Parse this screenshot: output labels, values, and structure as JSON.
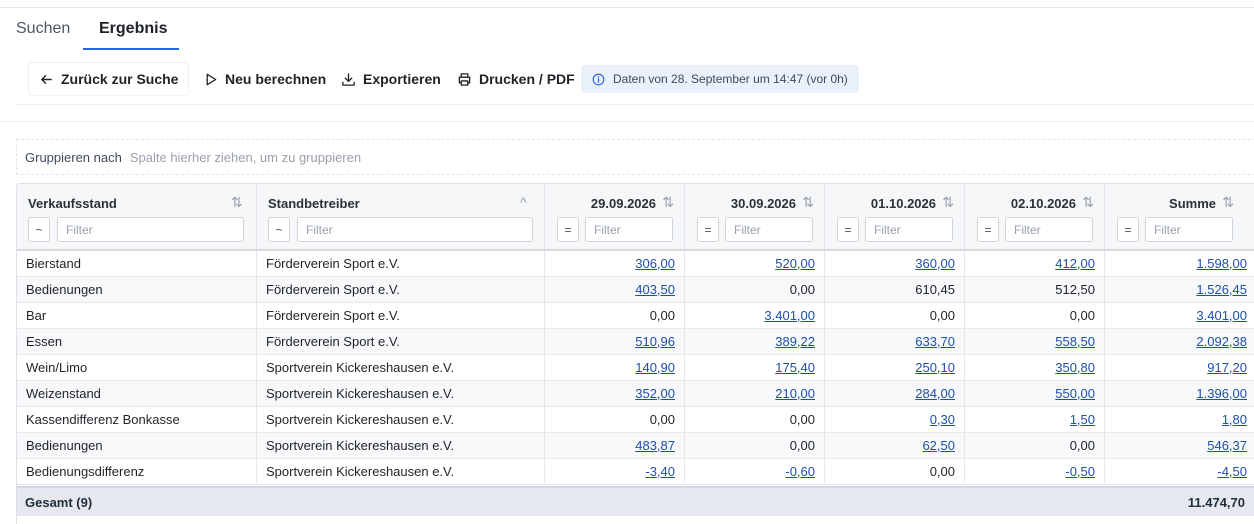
{
  "tabs": [
    {
      "label": "Suchen",
      "active": false
    },
    {
      "label": "Ergebnis",
      "active": true
    }
  ],
  "toolbar": {
    "back_label": "Zurück zur Suche",
    "recalc_label": "Neu berechnen",
    "export_label": "Exportieren",
    "print_label": "Drucken / PDF",
    "info_text": "Daten von 28. September um 14:47 (vor 0h)"
  },
  "group_bar": {
    "label": "Gruppieren nach",
    "hint": "Spalte hierher ziehen, um zu gruppieren"
  },
  "columns": [
    {
      "title": "Verkaufsstand",
      "sort": "⇅",
      "filter_op": "~",
      "filter_placeholder": "Filter"
    },
    {
      "title": "Standbetreiber",
      "sort": "^",
      "filter_op": "~",
      "filter_placeholder": "Filter"
    },
    {
      "title": "29.09.2026",
      "sort": "⇅",
      "filter_op": "=",
      "filter_placeholder": "Filter"
    },
    {
      "title": "30.09.2026",
      "sort": "⇅",
      "filter_op": "=",
      "filter_placeholder": "Filter"
    },
    {
      "title": "01.10.2026",
      "sort": "⇅",
      "filter_op": "=",
      "filter_placeholder": "Filter"
    },
    {
      "title": "02.10.2026",
      "sort": "⇅",
      "filter_op": "=",
      "filter_placeholder": "Filter"
    },
    {
      "title": "Summe",
      "sort": "⇅",
      "filter_op": "=",
      "filter_placeholder": "Filter"
    }
  ],
  "rows": [
    {
      "stand": "Bierstand",
      "operator": "Förderverein Sport e.V.",
      "d1": "306,00",
      "d2": "520,00",
      "d3": "360,00",
      "d4": "412,00",
      "sum": "1.598,00"
    },
    {
      "stand": "Bedienungen",
      "operator": "Förderverein Sport e.V.",
      "d1": "403,50",
      "d2": "0,00",
      "d3": "610,45",
      "d4": "512,50",
      "sum": "1.526,45"
    },
    {
      "stand": "Bar",
      "operator": "Förderverein Sport e.V.",
      "d1": "0,00",
      "d2": "3.401,00",
      "d3": "0,00",
      "d4": "0,00",
      "sum": "3.401,00"
    },
    {
      "stand": "Essen",
      "operator": "Förderverein Sport e.V.",
      "d1": "510,96",
      "d2": "389,22",
      "d3": "633,70",
      "d4": "558,50",
      "sum": "2.092,38"
    },
    {
      "stand": "Wein/Limo",
      "operator": "Sportverein Kickereshausen e.V.",
      "d1": "140,90",
      "d2": "175,40",
      "d3": "250,10",
      "d4": "350,80",
      "sum": "917,20"
    },
    {
      "stand": "Weizenstand",
      "operator": "Sportverein Kickereshausen e.V.",
      "d1": "352,00",
      "d2": "210,00",
      "d3": "284,00",
      "d4": "550,00",
      "sum": "1.396,00"
    },
    {
      "stand": "Kassendifferenz Bonkasse",
      "operator": "Sportverein Kickereshausen e.V.",
      "d1": "0,00",
      "d2": "0,00",
      "d3": "0,30",
      "d4": "1,50",
      "sum": "1,80"
    },
    {
      "stand": "Bedienungen",
      "operator": "Sportverein Kickereshausen e.V.",
      "d1": "483,87",
      "d2": "0,00",
      "d3": "62,50",
      "d4": "0,00",
      "sum": "546,37"
    },
    {
      "stand": "Bedienungsdifferenz",
      "operator": "Sportverein Kickereshausen e.V.",
      "d1": "-3,40",
      "d2": "-0,60",
      "d3": "0,00",
      "d4": "-0,50",
      "sum": "-4,50"
    }
  ],
  "total": {
    "label": "Gesamt (9)",
    "value": "11.474,70"
  }
}
